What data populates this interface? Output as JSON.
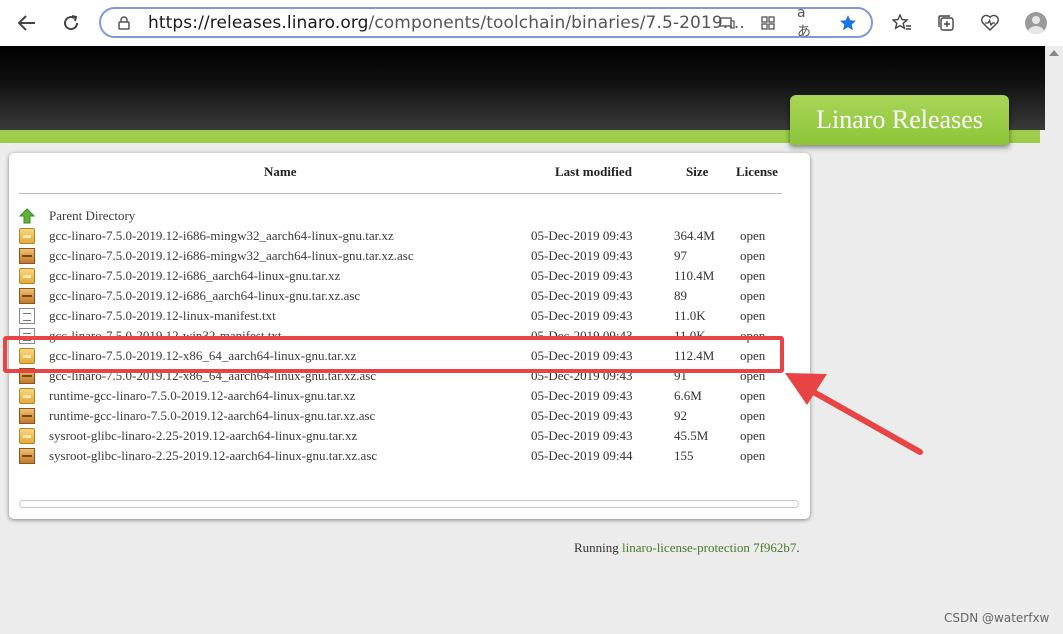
{
  "browser": {
    "url_host": "https://releases.linaro.org",
    "url_path": "/components/toolchain/binaries/7.5-2019....",
    "read_aloud_label": "aあ"
  },
  "page": {
    "header_tab": "Linaro Releases",
    "table_headers": {
      "name": "Name",
      "modified": "Last modified",
      "size": "Size",
      "license": "License"
    },
    "parent_directory": "Parent Directory",
    "rows": [
      {
        "name": "gcc-linaro-7.5.0-2019.12-i686-mingw32_aarch64-linux-gnu.tar.xz",
        "date": "05-Dec-2019 09:43",
        "size": "364.4M",
        "license": "open",
        "icon": "package-icon"
      },
      {
        "name": "gcc-linaro-7.5.0-2019.12-i686-mingw32_aarch64-linux-gnu.tar.xz.asc",
        "date": "05-Dec-2019 09:43",
        "size": "97",
        "license": "open",
        "icon": "signature-file-icon"
      },
      {
        "name": "gcc-linaro-7.5.0-2019.12-i686_aarch64-linux-gnu.tar.xz",
        "date": "05-Dec-2019 09:43",
        "size": "110.4M",
        "license": "open",
        "icon": "package-icon"
      },
      {
        "name": "gcc-linaro-7.5.0-2019.12-i686_aarch64-linux-gnu.tar.xz.asc",
        "date": "05-Dec-2019 09:43",
        "size": "89",
        "license": "open",
        "icon": "signature-file-icon"
      },
      {
        "name": "gcc-linaro-7.5.0-2019.12-linux-manifest.txt",
        "date": "05-Dec-2019 09:43",
        "size": "11.0K",
        "license": "open",
        "icon": "text-file-icon"
      },
      {
        "name": "gcc-linaro-7.5.0-2019.12-win32-manifest.txt",
        "date": "05-Dec-2019 09:43",
        "size": "11.0K",
        "license": "open",
        "icon": "text-file-icon"
      },
      {
        "name": "gcc-linaro-7.5.0-2019.12-x86_64_aarch64-linux-gnu.tar.xz",
        "date": "05-Dec-2019 09:43",
        "size": "112.4M",
        "license": "open",
        "icon": "package-icon"
      },
      {
        "name": "gcc-linaro-7.5.0-2019.12-x86_64_aarch64-linux-gnu.tar.xz.asc",
        "date": "05-Dec-2019 09:43",
        "size": "91",
        "license": "open",
        "icon": "signature-file-icon"
      },
      {
        "name": "runtime-gcc-linaro-7.5.0-2019.12-aarch64-linux-gnu.tar.xz",
        "date": "05-Dec-2019 09:43",
        "size": "6.6M",
        "license": "open",
        "icon": "package-icon"
      },
      {
        "name": "runtime-gcc-linaro-7.5.0-2019.12-aarch64-linux-gnu.tar.xz.asc",
        "date": "05-Dec-2019 09:43",
        "size": "92",
        "license": "open",
        "icon": "signature-file-icon"
      },
      {
        "name": "sysroot-glibc-linaro-2.25-2019.12-aarch64-linux-gnu.tar.xz",
        "date": "05-Dec-2019 09:43",
        "size": "45.5M",
        "license": "open",
        "icon": "package-icon"
      },
      {
        "name": "sysroot-glibc-linaro-2.25-2019.12-aarch64-linux-gnu.tar.xz.asc",
        "date": "05-Dec-2019 09:44",
        "size": "155",
        "license": "open",
        "icon": "signature-file-icon"
      }
    ],
    "footer_prefix": "Running ",
    "footer_link": "linaro-license-protection 7f962b7",
    "footer_suffix": "."
  },
  "annotation": {
    "highlight_color": "#e84444"
  },
  "colors": {
    "accent_green": "#9dcd4c",
    "favorite_star": "#1a73e8"
  },
  "watermark": "CSDN @waterfxw"
}
